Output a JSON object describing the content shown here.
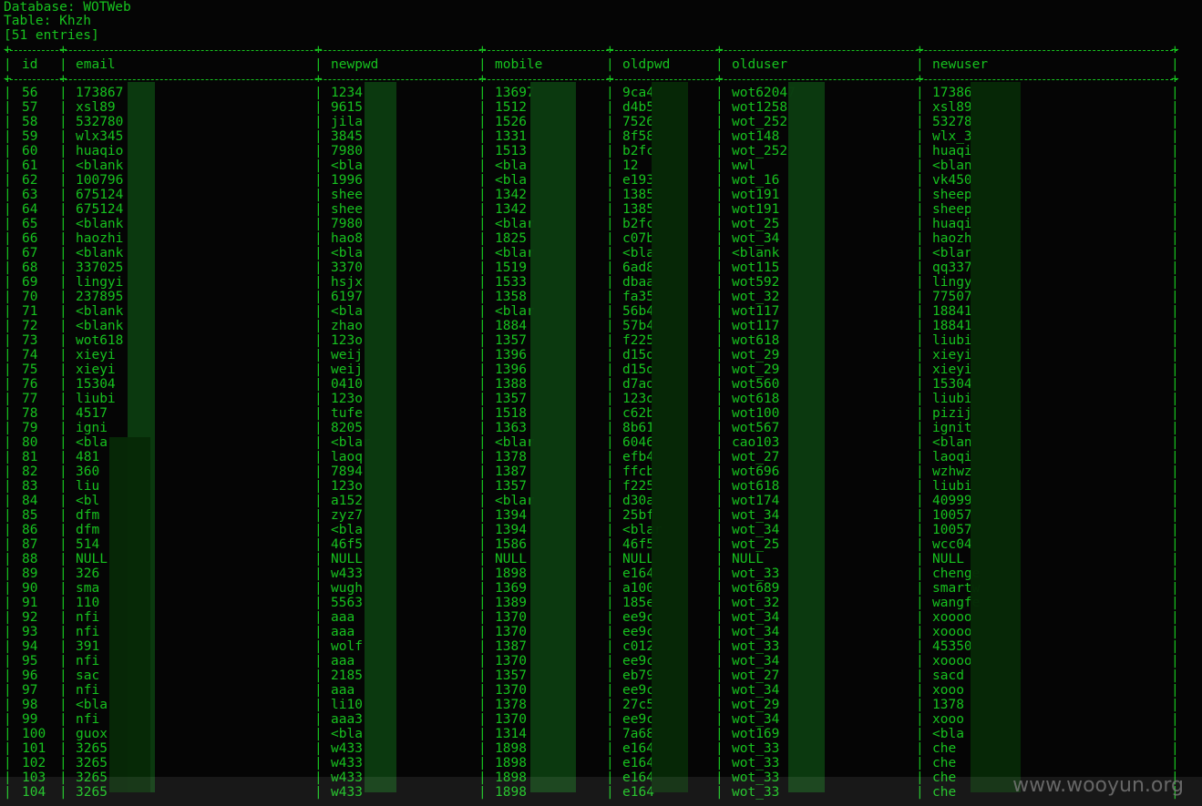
{
  "header": {
    "database_line": "Database: WOTWeb",
    "table_line": "Table: Khzh",
    "entries_line": "[51 entries]"
  },
  "columns": [
    "id",
    "email",
    "newpwd",
    "mobile",
    "oldpwd",
    "olduser",
    "newuser"
  ],
  "rows": [
    [
      "56",
      "173867",
      "1234",
      "13697",
      "9ca4",
      "wot62047",
      "17386"
    ],
    [
      "57",
      "xsl89",
      "9615",
      "1512",
      "d4b5",
      "wot1258",
      "xsl89"
    ],
    [
      "58",
      "532780",
      "jila",
      "1526",
      "7526",
      "wot_252",
      "53278"
    ],
    [
      "59",
      "wlx345",
      "3845",
      "1331",
      "8f58",
      "wot148",
      "wlx_3"
    ],
    [
      "60",
      "huaqio",
      "7980",
      "1513",
      "b2fc",
      "wot_252",
      "huaqi"
    ],
    [
      "61",
      "<blank",
      "<bla",
      "<bla",
      "12",
      "wwl",
      "<blan"
    ],
    [
      "62",
      "100796",
      "1996",
      "<bla",
      "e193",
      "wot_16",
      "vk450"
    ],
    [
      "63",
      "675124",
      "shee",
      "1342",
      "1385",
      "wot191",
      "sheep"
    ],
    [
      "64",
      "675124",
      "shee",
      "1342",
      "1385",
      "wot191",
      "sheep"
    ],
    [
      "65",
      "<blank",
      "7980",
      "<blar",
      "b2fc",
      "wot_25",
      "huaqi"
    ],
    [
      "66",
      "haozhi",
      "hao8",
      "1825",
      "c07b",
      "wot_34",
      "haozh"
    ],
    [
      "67",
      "<blank",
      "<bla",
      "<blar",
      "<bla",
      "<blank",
      "<blar"
    ],
    [
      "68",
      "337025",
      "3370",
      "1519",
      "6ad8",
      "wot115",
      "qq337"
    ],
    [
      "69",
      "lingyi",
      "hsjx",
      "1533",
      "dbaa",
      "wot592",
      "lingy"
    ],
    [
      "70",
      "237895",
      "6197",
      "1358",
      "fa35",
      "wot_32",
      "77507"
    ],
    [
      "71",
      "<blank",
      "<bla",
      "<blar",
      "56b4",
      "wot117",
      "18841"
    ],
    [
      "72",
      "<blank",
      "zhao",
      "1884",
      "57b4",
      "wot117",
      "18841"
    ],
    [
      "73",
      "wot618",
      "123o",
      "1357",
      "f225",
      "wot618",
      "liubi"
    ],
    [
      "74",
      "xieyi",
      "weij",
      "1396",
      "d15d",
      "wot_29",
      "xieyi"
    ],
    [
      "75",
      "xieyi",
      "weij",
      "1396",
      "d15d",
      "wot_29",
      "xieyi"
    ],
    [
      "76",
      "15304",
      "0410",
      "1388",
      "d7ad",
      "wot560",
      "15304"
    ],
    [
      "77",
      "liubi",
      "123o",
      "1357",
      "123o",
      "wot618",
      "liubi"
    ],
    [
      "78",
      "4517",
      "tufe",
      "1518",
      "c62b",
      "wot100",
      "pizij"
    ],
    [
      "79",
      "igni",
      "8205",
      "1363",
      "8b61",
      "wot567",
      "ignit"
    ],
    [
      "80",
      "<bla",
      "<blar",
      "<blar",
      "6046",
      "cao103",
      "<blan"
    ],
    [
      "81",
      "481",
      "laoq",
      "1378",
      "efb4",
      "wot_27",
      "laoqi"
    ],
    [
      "82",
      "360",
      "7894",
      "1387",
      "ffcb",
      "wot696",
      "wzhwz"
    ],
    [
      "83",
      "liu",
      "123o",
      "1357",
      "f225",
      "wot618",
      "liubi"
    ],
    [
      "84",
      "<bl",
      "a152",
      "<blar",
      "d30a",
      "wot174",
      "40999"
    ],
    [
      "85",
      "dfm",
      "zyz7",
      "1394",
      "25bf",
      "wot_34",
      "10057"
    ],
    [
      "86",
      "dfm",
      "<bla",
      "1394",
      "<blar",
      "wot_34",
      "10057"
    ],
    [
      "87",
      "514",
      "46f5",
      "1586",
      "46f5",
      "wot_25",
      "wcc04"
    ],
    [
      "88",
      "NULL",
      "NULL",
      "NULL",
      "NULL",
      "NULL",
      "NULL"
    ],
    [
      "89",
      "326",
      "w433",
      "1898",
      "e164",
      "wot_33",
      "chenge"
    ],
    [
      "90",
      "sma",
      "wugh",
      "1369",
      "a100",
      "wot689",
      "smartw"
    ],
    [
      "91",
      "110",
      "5563",
      "1389",
      "185e",
      "wot_32",
      "wangfe"
    ],
    [
      "92",
      "nfi",
      "aaa",
      "1370",
      "ee9c",
      "wot_34",
      "xoooo"
    ],
    [
      "93",
      "nfi",
      "aaa",
      "1370",
      "ee9c",
      "wot_34",
      "xoooo"
    ],
    [
      "94",
      "391",
      "wolf",
      "1387",
      "c012",
      "wot_33",
      "45350"
    ],
    [
      "95",
      "nfi",
      "aaa",
      "1370",
      "ee9c",
      "wot_34",
      "xoooo"
    ],
    [
      "96",
      "sac",
      "2185",
      "1357",
      "eb79",
      "wot_27",
      "sacd"
    ],
    [
      "97",
      "nfi",
      "aaa",
      "1370",
      "ee9c",
      "wot_34",
      "xooo"
    ],
    [
      "98",
      "<bla",
      "li10",
      "1378",
      "27c5",
      "wot_29",
      "1378"
    ],
    [
      "99",
      "nfi",
      "aaa3",
      "1370",
      "ee9c",
      "wot_34",
      "xooo"
    ],
    [
      "100",
      "guox",
      "<bla",
      "1314",
      "7a68",
      "wot169",
      "<bla"
    ],
    [
      "101",
      "3265",
      "w433",
      "1898",
      "e164",
      "wot_33",
      "che"
    ],
    [
      "102",
      "3265",
      "w433",
      "1898",
      "e164",
      "wot_33",
      "che"
    ],
    [
      "103",
      "3265",
      "w433",
      "1898",
      "e164",
      "wot_33",
      "che"
    ],
    [
      "104",
      "3265",
      "w433",
      "1898",
      "e164",
      "wot_33",
      "che"
    ]
  ],
  "watermark": "www.wooyun.org"
}
